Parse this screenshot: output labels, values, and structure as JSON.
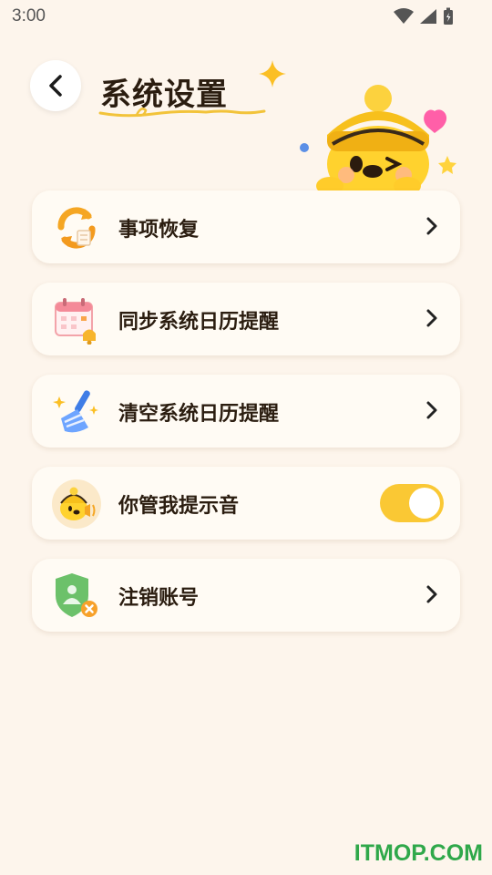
{
  "status": {
    "time": "3:00"
  },
  "header": {
    "title": "系统设置"
  },
  "menu": [
    {
      "label": "事项恢复",
      "icon": "restore-icon"
    },
    {
      "label": "同步系统日历提醒",
      "icon": "calendar-bell-icon"
    },
    {
      "label": "清空系统日历提醒",
      "icon": "broom-icon"
    },
    {
      "label": "你管我提示音",
      "icon": "mascot-sound-icon",
      "toggle_on": true
    },
    {
      "label": "注销账号",
      "icon": "shield-user-cancel-icon"
    }
  ],
  "colors": {
    "background": "#fdf5ec",
    "accent": "#fac834",
    "text": "#2b1d10"
  },
  "watermark": "ITMOP.COM"
}
